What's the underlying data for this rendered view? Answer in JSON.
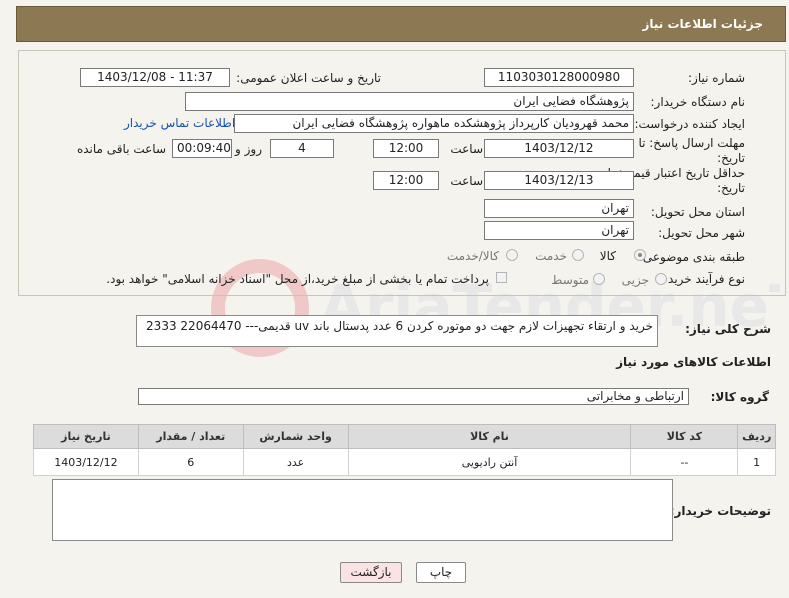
{
  "header": {
    "title": "جزئیات اطلاعات نیاز"
  },
  "form": {
    "need_number": {
      "label": "شماره نیاز:",
      "value": "1103030128000980"
    },
    "announce_datetime": {
      "label": "تاریخ و ساعت اعلان عمومی:",
      "value": "1403/12/08 - 11:37"
    },
    "buyer_org": {
      "label": "نام دستگاه خریدار:",
      "value": "پژوهشگاه فضایی ایران"
    },
    "requester": {
      "label": "ایجاد کننده درخواست:",
      "value": "محمد قهرودیان کارپرداز پژوهشکده ماهواره پژوهشگاه فضایی ایران",
      "contact_link": "اطلاعات تماس خریدار"
    },
    "reply_deadline": {
      "label_line1": "مهلت ارسال پاسخ: تا",
      "label_line2": "تاریخ:",
      "date": "1403/12/12",
      "time_label": "ساعت",
      "time": "12:00",
      "days": "4",
      "days_label": "روز و",
      "remaining": "00:09:40",
      "remaining_label": "ساعت باقی مانده"
    },
    "price_validity": {
      "label_line1": "حداقل تاریخ اعتبار قیمت: تا",
      "label_line2": "تاریخ:",
      "date": "1403/12/13",
      "time_label": "ساعت",
      "time": "12:00"
    },
    "delivery_province": {
      "label": "استان محل تحویل:",
      "value": "تهران"
    },
    "delivery_city": {
      "label": "شهر محل تحویل:",
      "value": "تهران"
    },
    "category": {
      "label": "طبقه بندی موضوعی:",
      "options": [
        "کالا",
        "خدمت",
        "کالا/خدمت"
      ],
      "selected": "کالا"
    },
    "purchase_process": {
      "label": "نوع فرآیند خرید :",
      "options": [
        "جزیی",
        "متوسط"
      ],
      "payment_note": "پرداخت تمام یا بخشی از مبلغ خرید،از محل \"اسناد خزانه اسلامی\" خواهد بود."
    }
  },
  "description": {
    "label": "شرح کلی نیاز:",
    "value": "خرید و ارتقاء تجهیزات لازم جهت دو موتوره کردن 6 عدد پدستال باند uv قدیمی--- 22064470 2333"
  },
  "goods_info": {
    "title": "اطلاعات کالاهای مورد نیاز",
    "group_label": "گروه کالا:",
    "group_value": "ارتباطی و مخابراتی",
    "columns": [
      "ردیف",
      "کد کالا",
      "نام کالا",
      "واحد شمارش",
      "تعداد / مقدار",
      "تاریخ نیاز"
    ],
    "rows": [
      {
        "index": "1",
        "code": "--",
        "name": "آنتن رادیویی",
        "unit": "عدد",
        "qty": "6",
        "date": "1403/12/12"
      }
    ]
  },
  "buyer_notes": {
    "label": "توضیحات خریدار:",
    "value": ""
  },
  "buttons": {
    "print": "چاپ",
    "back": "بازگشت"
  },
  "colors": {
    "header_bg": "#8c7853",
    "link": "#1a4fb4",
    "back_button": "#fbe3e3"
  }
}
